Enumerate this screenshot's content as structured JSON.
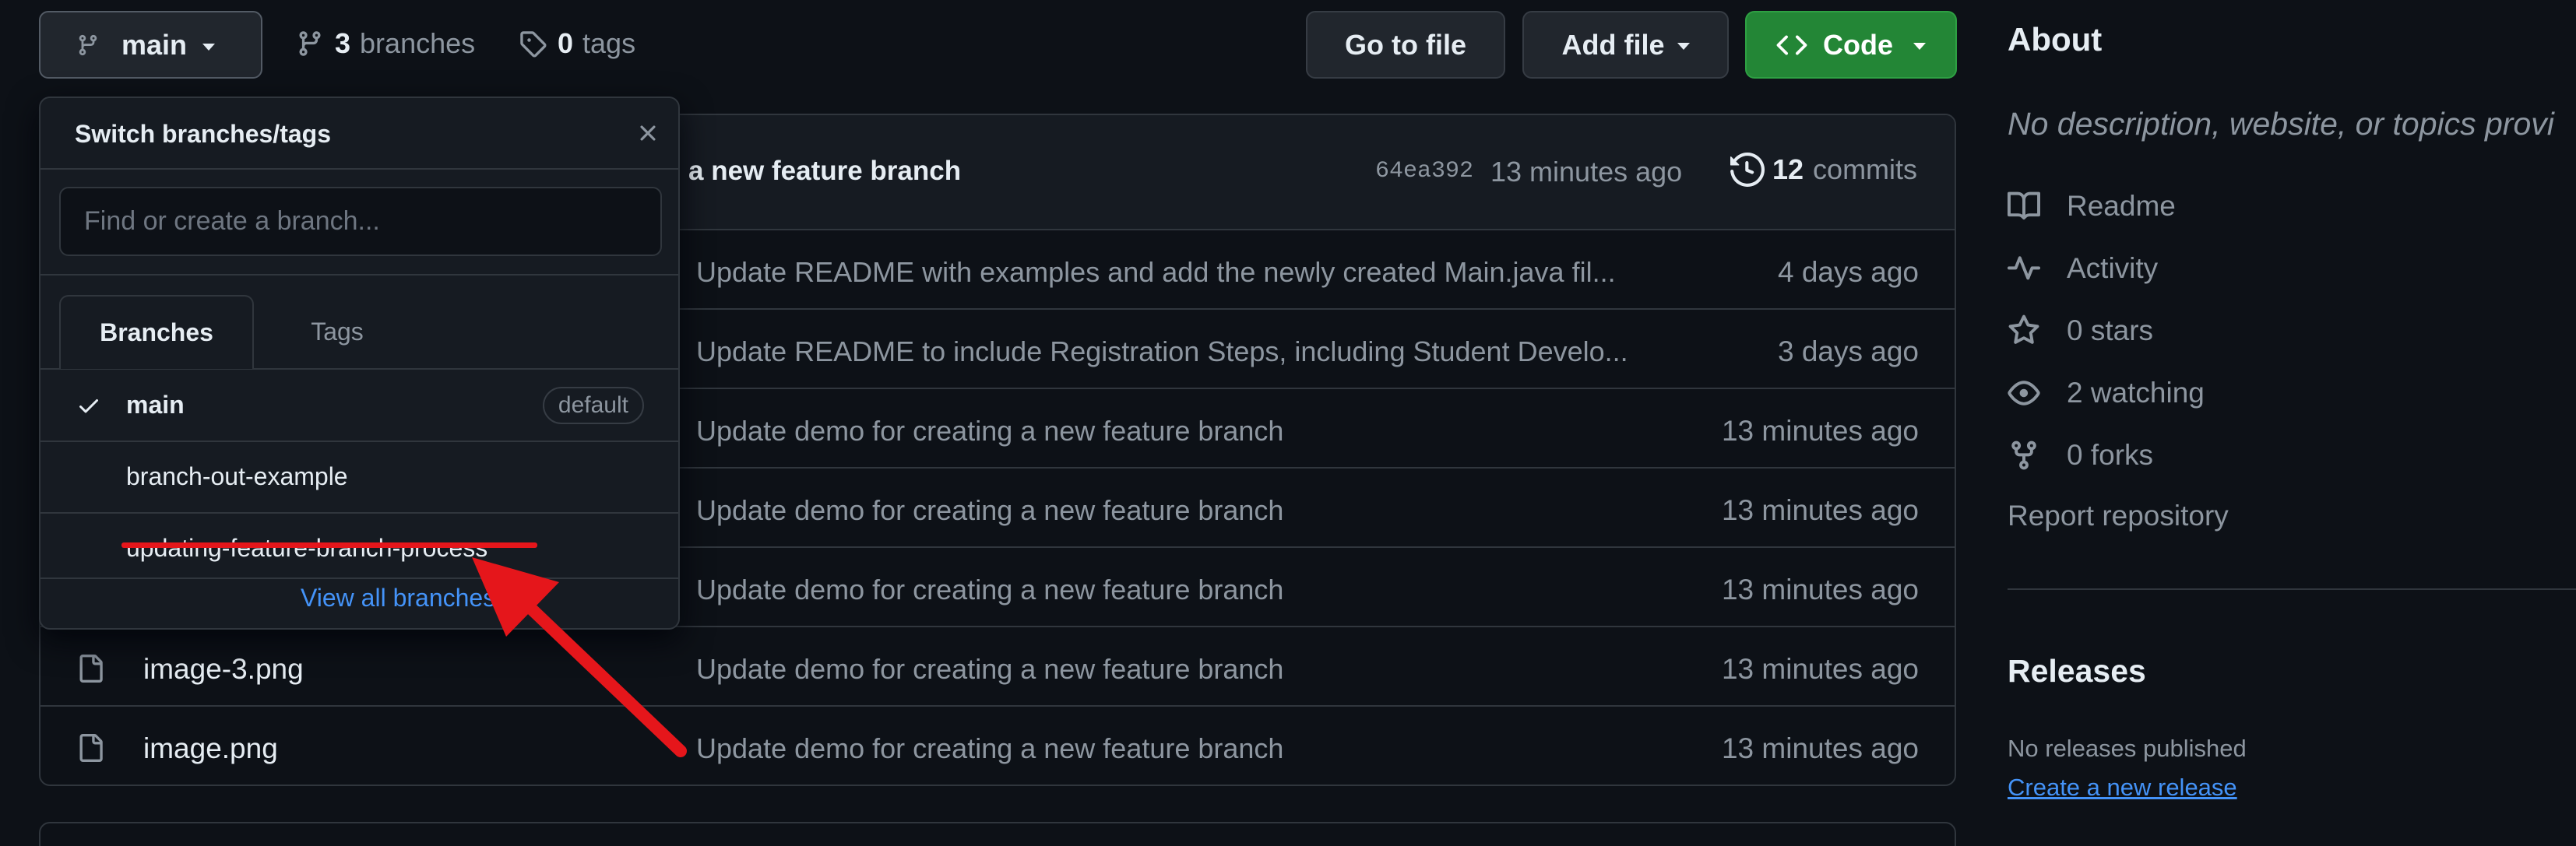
{
  "toolbar": {
    "branch": "main",
    "branches_count": "3",
    "branches_label": "branches",
    "tags_count": "0",
    "tags_label": "tags",
    "go_to_file": "Go to file",
    "add_file": "Add file",
    "code": "Code"
  },
  "latest_commit": {
    "message": "a new feature branch",
    "sha": "64ea392",
    "time": "13 minutes ago",
    "commits_count": "12",
    "commits_label": "commits"
  },
  "files": [
    {
      "name": "",
      "message": "Update README with examples and add the newly created Main.java fil...",
      "time": "4 days ago"
    },
    {
      "name": "",
      "message": "Update README to include Registration Steps, including Student Develo...",
      "time": "3 days ago"
    },
    {
      "name": "",
      "message": "Update demo for creating a new feature branch",
      "time": "13 minutes ago"
    },
    {
      "name": "",
      "message": "Update demo for creating a new feature branch",
      "time": "13 minutes ago"
    },
    {
      "name": "",
      "message": "Update demo for creating a new feature branch",
      "time": "13 minutes ago"
    },
    {
      "name": "image-3.png",
      "message": "Update demo for creating a new feature branch",
      "time": "13 minutes ago"
    },
    {
      "name": "image.png",
      "message": "Update demo for creating a new feature branch",
      "time": "13 minutes ago"
    }
  ],
  "dropdown": {
    "title": "Switch branches/tags",
    "search_placeholder": "Find or create a branch...",
    "tabs": [
      "Branches",
      "Tags"
    ],
    "branches": [
      {
        "name": "main",
        "badge": "default",
        "selected": true
      },
      {
        "name": "branch-out-example"
      },
      {
        "name": "updating-feature-branch-process"
      }
    ],
    "view_all": "View all branches"
  },
  "about": {
    "title": "About",
    "description": "No description, website, or topics provi",
    "readme": "Readme",
    "activity": "Activity",
    "stars": "0 stars",
    "watching": "2 watching",
    "forks": "0 forks",
    "report": "Report repository"
  },
  "releases": {
    "title": "Releases",
    "none": "No releases published",
    "create": "Create a new release"
  },
  "colors": {
    "background": "#0d1117",
    "accent_green": "#238636",
    "link_blue": "#4493f8",
    "annotation_red": "#e5161b"
  }
}
